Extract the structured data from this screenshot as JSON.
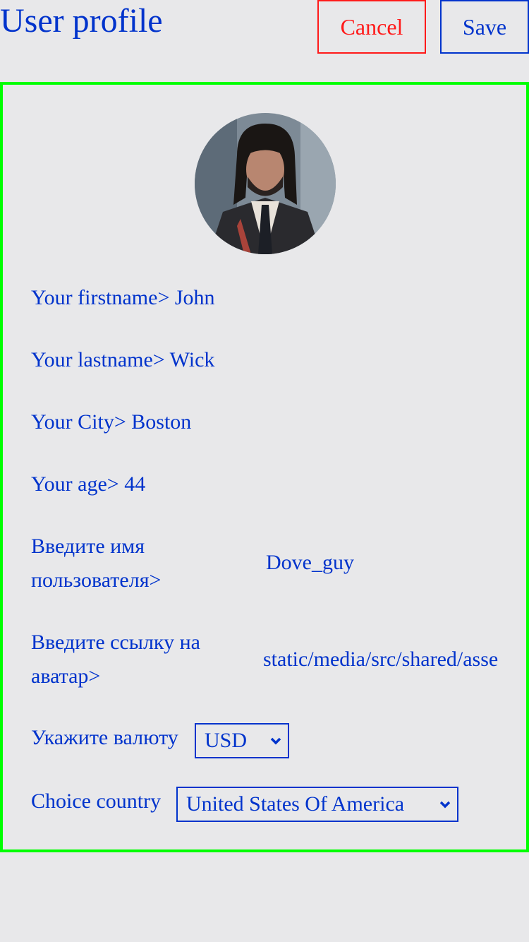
{
  "header": {
    "title": "User profile",
    "cancel_label": "Cancel",
    "save_label": "Save"
  },
  "profile": {
    "fields": [
      {
        "label": "Your firstname>",
        "value": "John"
      },
      {
        "label": "Your lastname>",
        "value": "Wick"
      },
      {
        "label": "Your City>",
        "value": "Boston"
      },
      {
        "label": "Your age>",
        "value": "44"
      }
    ],
    "username": {
      "label_line1": "Введите имя",
      "label_line2": "пользователя>",
      "value": "Dove_guy"
    },
    "avatar_link": {
      "label_line1": "Введите ссылку на",
      "label_line2": "аватар>",
      "value": "static/media/src/shared/assets"
    },
    "currency": {
      "label": "Укажите валюту",
      "selected": "USD"
    },
    "country": {
      "label": "Choice country",
      "selected": "United States Of America"
    }
  },
  "colors": {
    "accent": "#0033cc",
    "cancel": "#ff1a1a",
    "panel_border": "#00ff00",
    "background": "#e8e8ea"
  }
}
